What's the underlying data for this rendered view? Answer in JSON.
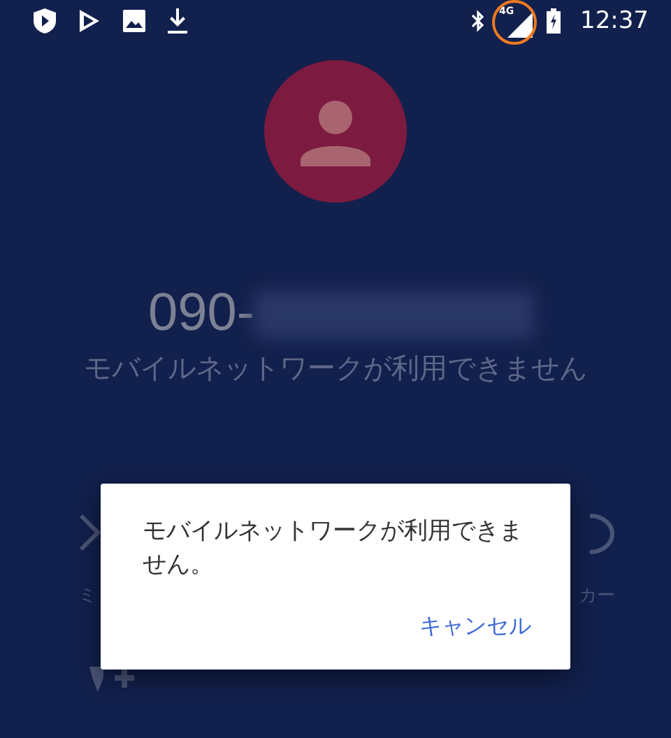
{
  "status_bar": {
    "time": "12:37",
    "network_label": "4G"
  },
  "call": {
    "number_visible": "090-",
    "status": "モバイルネットワークが利用できません",
    "button_labels": [
      "ミ",
      "カー"
    ]
  },
  "dialog": {
    "message": "モバイルネットワークが利用できません。",
    "button": "キャンセル"
  }
}
